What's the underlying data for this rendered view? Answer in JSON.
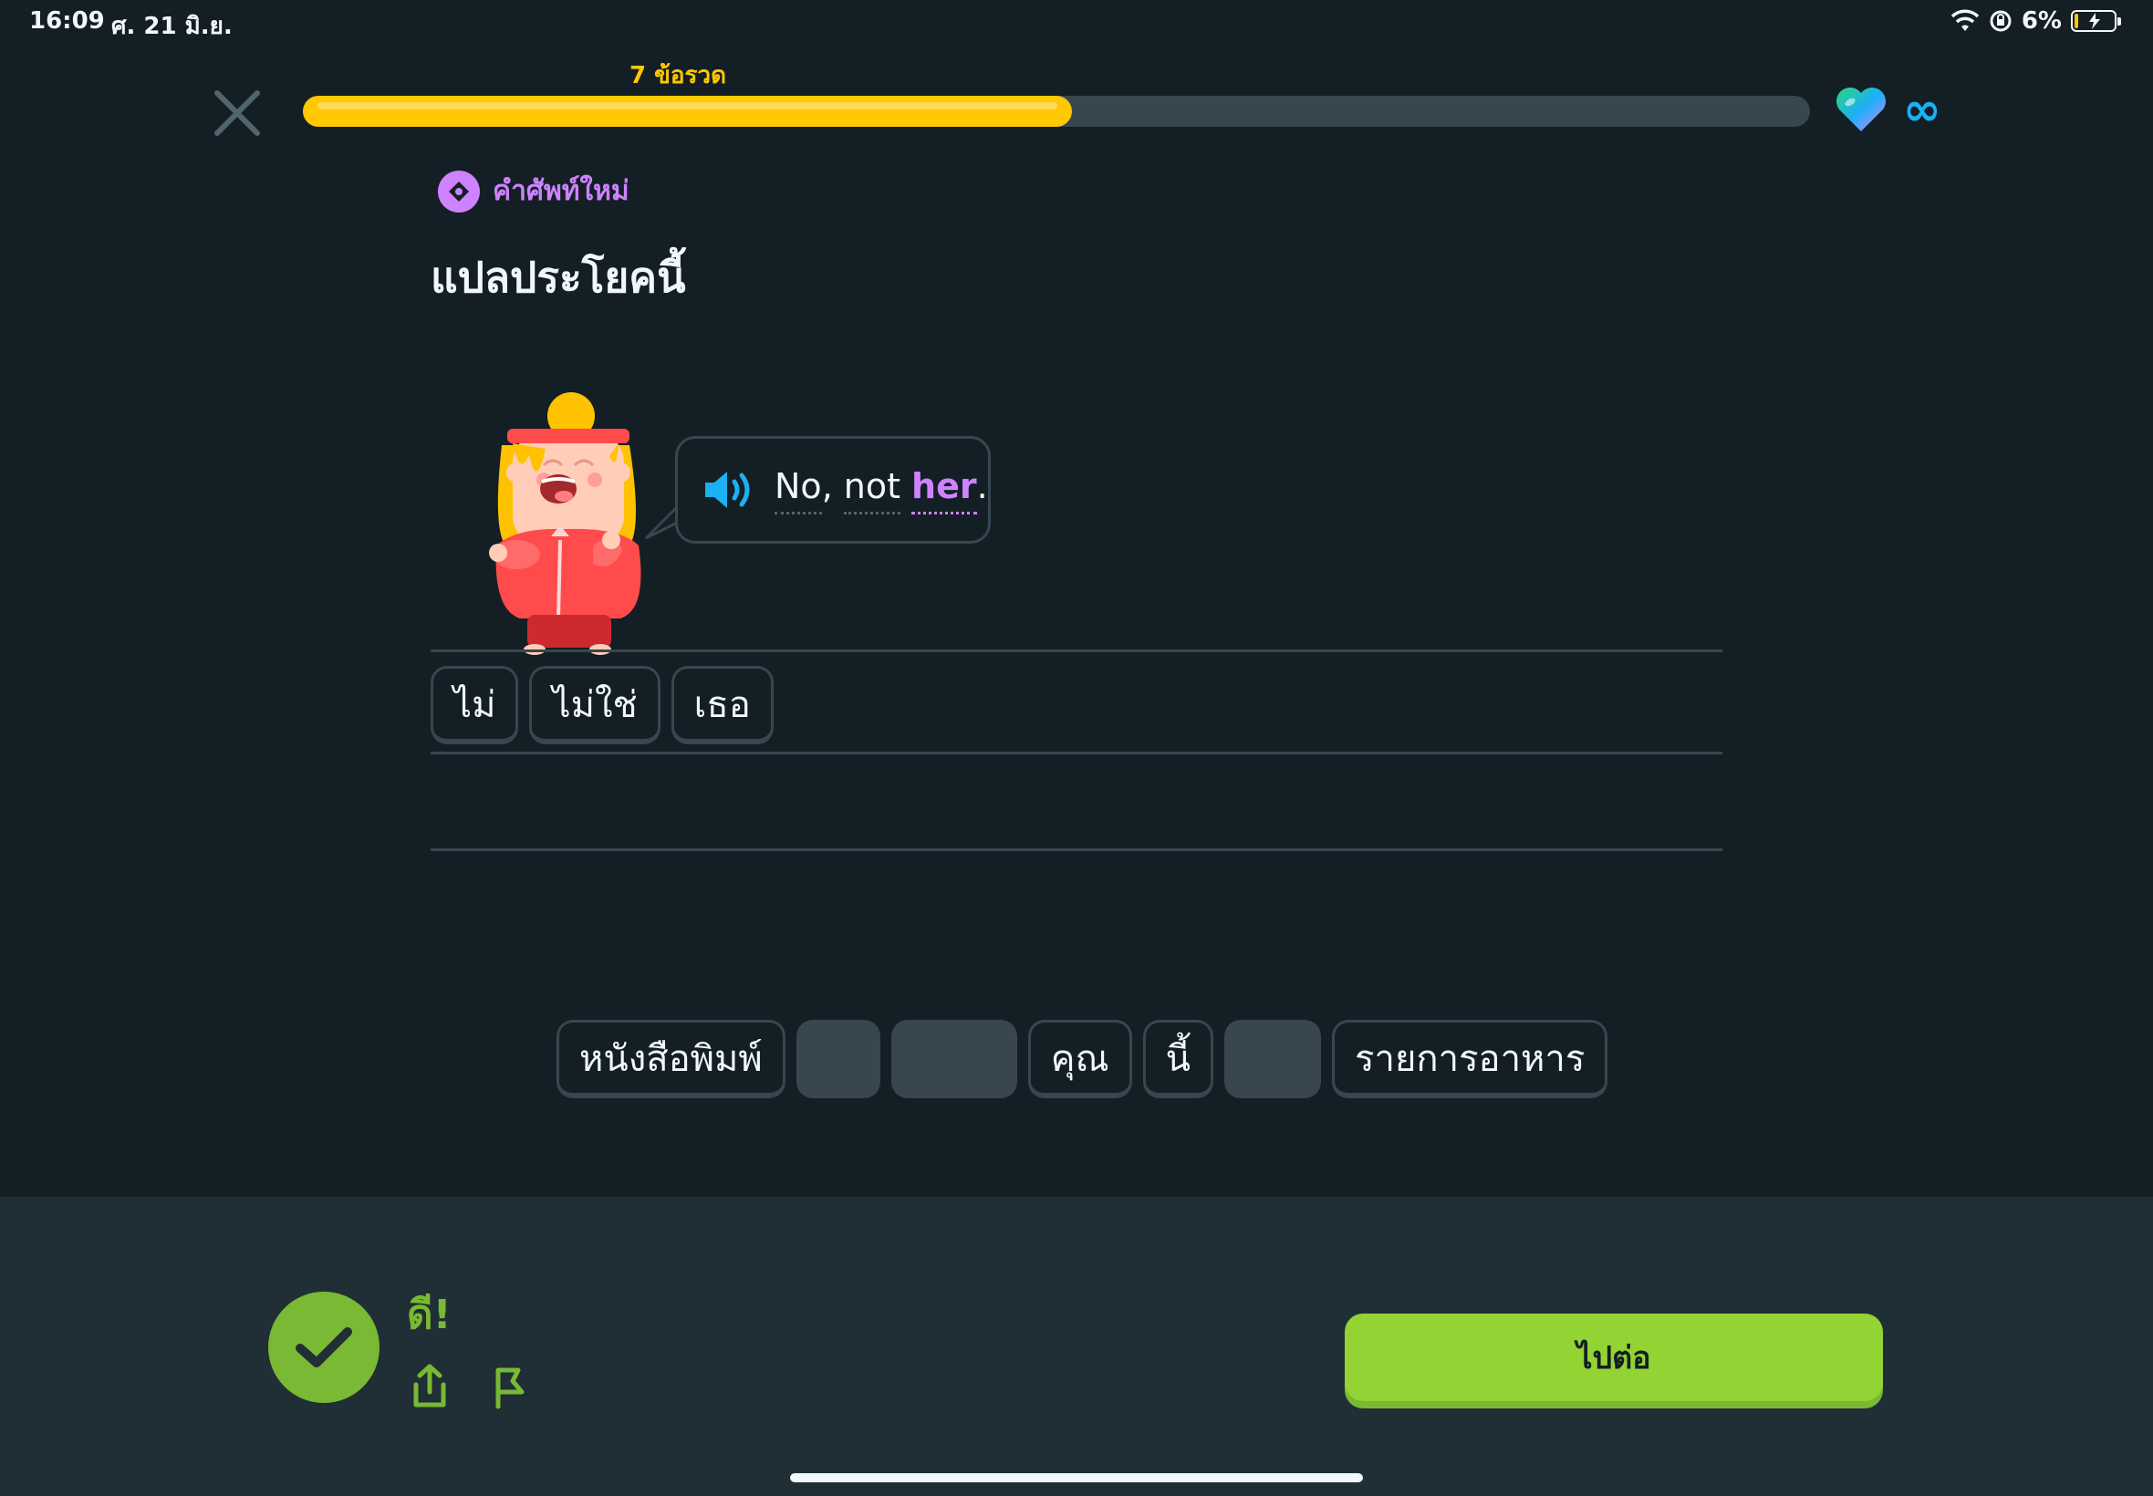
{
  "status_bar": {
    "time": "16:09",
    "date": "ศ. 21 มิ.ย.",
    "battery": "6%",
    "battery_level": 0.06
  },
  "header": {
    "streak_label": "7 ข้อรวด",
    "progress": 0.51,
    "hearts": "∞",
    "close_icon": "close-icon"
  },
  "prompt": {
    "tag": "คำศัพท์ใหม่",
    "title": "แปลประโยคนี้",
    "sentence_words": [
      "No",
      "not",
      "her"
    ],
    "sentence_punct": [
      ",",
      "."
    ],
    "speaker_icon": "speaker-icon"
  },
  "answer_tiles": [
    "ไม่",
    "ไม่ใช่",
    "เธอ"
  ],
  "word_bank": [
    {
      "label": "หนังสือพิมพ์",
      "empty": false
    },
    {
      "label": "",
      "empty": true
    },
    {
      "label": "",
      "empty": true
    },
    {
      "label": "คุณ",
      "empty": false
    },
    {
      "label": "นี้",
      "empty": false
    },
    {
      "label": "",
      "empty": true
    },
    {
      "label": "รายการอาหาร",
      "empty": false
    }
  ],
  "footer": {
    "feedback": "ดี!",
    "continue_label": "ไปต่อ"
  },
  "colors": {
    "background": "#131f24",
    "footer": "#202f36",
    "progress": "#ffc800",
    "accent_purple": "#ce82ff",
    "success_green": "#79b933",
    "button_green": "#93d333",
    "border": "#37464f"
  }
}
